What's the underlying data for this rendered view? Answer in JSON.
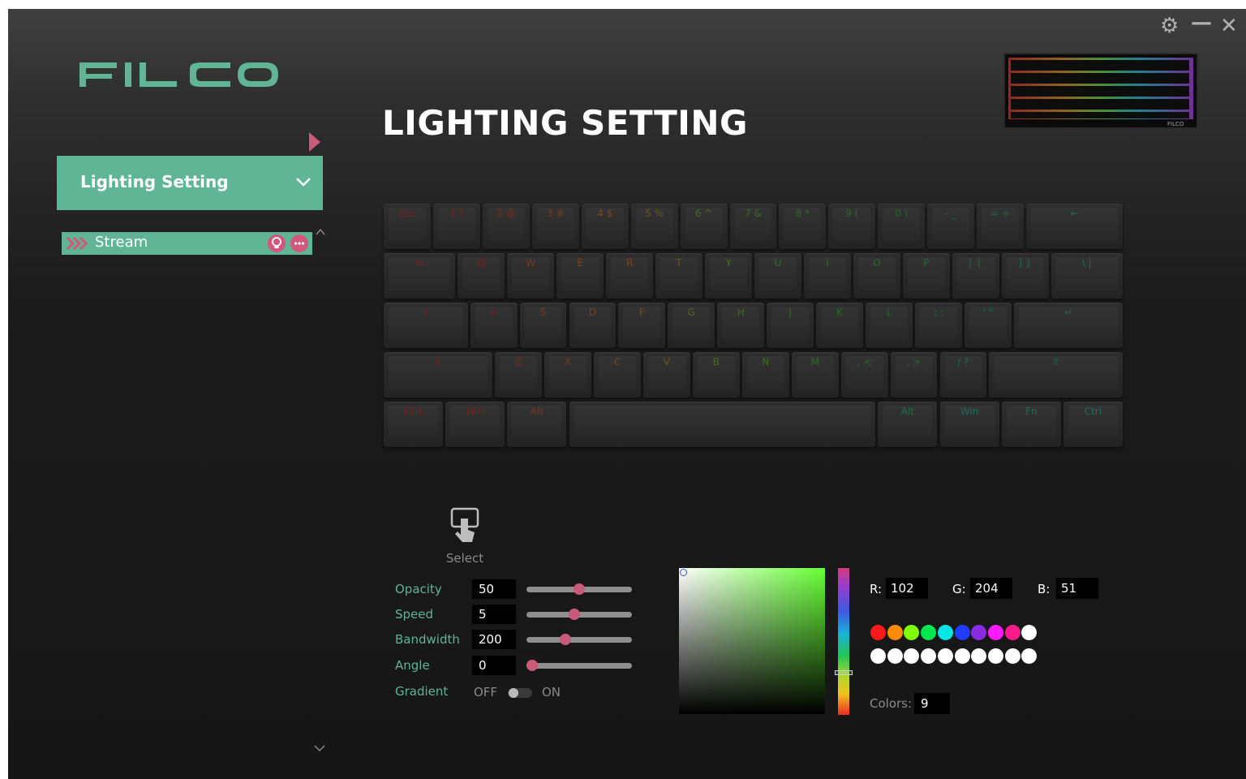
{
  "window": {
    "gear_glyph": "⚙",
    "minimize_glyph": "—",
    "close_glyph": "✕"
  },
  "brand": {
    "logo_text": "FILCO",
    "accent": "#5fb596",
    "secondary_accent": "#c85a7a"
  },
  "page_title": "LIGHTING SETTING",
  "sidebar": {
    "menu_header": "Lighting Setting",
    "profile": {
      "name": "Stream"
    }
  },
  "keyboard": {
    "rows": [
      [
        {
          "t": "Esc",
          "c": "#7a2020"
        },
        {
          "t": "1 !",
          "c": "#7a2020"
        },
        {
          "t": "2 @",
          "c": "#7a2a20"
        },
        {
          "t": "3 #",
          "c": "#7a3520"
        },
        {
          "t": "4 $",
          "c": "#7a4520"
        },
        {
          "t": "5 %",
          "c": "#6a5520"
        },
        {
          "t": "6 ^",
          "c": "#4a6a25"
        },
        {
          "t": "7 &",
          "c": "#3a6a25"
        },
        {
          "t": "8 *",
          "c": "#2f6a25"
        },
        {
          "t": "9 (",
          "c": "#276a25"
        },
        {
          "t": "0 )",
          "c": "#206a25"
        },
        {
          "t": "- _",
          "c": "#206a35"
        },
        {
          "t": "= +",
          "c": "#206a45"
        },
        {
          "t": "←",
          "c": "#206a55"
        }
      ],
      [
        {
          "t": "⇆",
          "c": "#7a2020"
        },
        {
          "t": "Q",
          "c": "#7a2020"
        },
        {
          "t": "W",
          "c": "#7a3520"
        },
        {
          "t": "E",
          "c": "#7a4020"
        },
        {
          "t": "R",
          "c": "#7a4520"
        },
        {
          "t": "T",
          "c": "#6a5520"
        },
        {
          "t": "Y",
          "c": "#4a6a25"
        },
        {
          "t": "U",
          "c": "#3a6a25"
        },
        {
          "t": "I",
          "c": "#2f6a25"
        },
        {
          "t": "O",
          "c": "#276a25"
        },
        {
          "t": "P",
          "c": "#206a25"
        },
        {
          "t": "[ {",
          "c": "#206a35"
        },
        {
          "t": "] }",
          "c": "#206a45"
        },
        {
          "t": "\\ |",
          "c": "#206a55"
        }
      ],
      [
        {
          "t": "⇪",
          "c": "#7a2020"
        },
        {
          "t": "A",
          "c": "#7a2020"
        },
        {
          "t": "S",
          "c": "#7a3520"
        },
        {
          "t": "D",
          "c": "#7a4020"
        },
        {
          "t": "F",
          "c": "#6a5020"
        },
        {
          "t": "G",
          "c": "#5a6020"
        },
        {
          "t": "H",
          "c": "#3a6a25"
        },
        {
          "t": "J",
          "c": "#2f6a25"
        },
        {
          "t": "K",
          "c": "#276a25"
        },
        {
          "t": "L",
          "c": "#206a25"
        },
        {
          "t": "; :",
          "c": "#206a35"
        },
        {
          "t": "' \"",
          "c": "#206a45"
        },
        {
          "t": "↵",
          "c": "#206a55"
        }
      ],
      [
        {
          "t": "⇧",
          "c": "#7a2020"
        },
        {
          "t": "Z",
          "c": "#7a2a20"
        },
        {
          "t": "X",
          "c": "#7a3520"
        },
        {
          "t": "C",
          "c": "#7a4520"
        },
        {
          "t": "V",
          "c": "#6a5520"
        },
        {
          "t": "B",
          "c": "#4a6a25"
        },
        {
          "t": "N",
          "c": "#3a6a25"
        },
        {
          "t": "M",
          "c": "#2f6a25"
        },
        {
          "t": ", <",
          "c": "#276a25"
        },
        {
          "t": ". >",
          "c": "#206a35"
        },
        {
          "t": "/ ?",
          "c": "#206a45"
        },
        {
          "t": "⇧",
          "c": "#206a55"
        }
      ],
      [
        {
          "t": "Ctrl",
          "c": "#7a2020"
        },
        {
          "t": "Win",
          "c": "#7a2020"
        },
        {
          "t": "Alt",
          "c": "#7a3520"
        },
        {
          "t": "",
          "c": "#4a6a25"
        },
        {
          "t": "Alt",
          "c": "#206a45"
        },
        {
          "t": "Win",
          "c": "#206a55"
        },
        {
          "t": "Fn",
          "c": "#206a55"
        },
        {
          "t": "Ctrl",
          "c": "#206a65"
        }
      ]
    ]
  },
  "tool": {
    "select_label": "Select"
  },
  "params": {
    "opacity": {
      "label": "Opacity",
      "value": "50",
      "level": 0.5
    },
    "speed": {
      "label": "Speed",
      "value": "5",
      "level": 0.45
    },
    "bandwidth": {
      "label": "Bandwidth",
      "value": "200",
      "level": 0.35
    },
    "angle": {
      "label": "Angle",
      "value": "0",
      "level": 0.0
    },
    "gradient": {
      "label": "Gradient",
      "off": "OFF",
      "on": "ON",
      "state": "off"
    }
  },
  "color": {
    "r_label": "R:",
    "g_label": "G:",
    "b_label": "B:",
    "r": "102",
    "g": "204",
    "b": "51",
    "palette_row1": [
      "#ff1a1a",
      "#ff8c00",
      "#7fff00",
      "#00e64d",
      "#00e6e6",
      "#1f3cff",
      "#8a2be2",
      "#ff1aff",
      "#ff1a8c",
      "#ffffff"
    ],
    "palette_row2": [
      "#ffffff",
      "#ffffff",
      "#ffffff",
      "#ffffff",
      "#ffffff",
      "#ffffff",
      "#ffffff",
      "#ffffff",
      "#ffffff",
      "#ffffff"
    ],
    "colors_label": "Colors:",
    "colors_count": "9"
  }
}
